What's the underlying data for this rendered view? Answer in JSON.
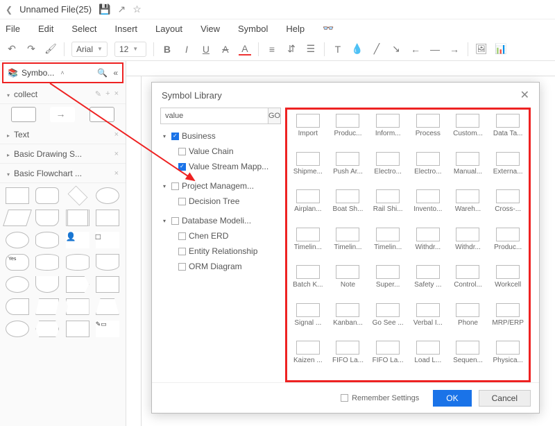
{
  "title": "Unnamed File(25)",
  "menu": [
    "File",
    "Edit",
    "Select",
    "Insert",
    "Layout",
    "View",
    "Symbol",
    "Help"
  ],
  "font": {
    "family": "Arial",
    "size": "12"
  },
  "sidebar": {
    "head": "Symbo...",
    "collect": "collect",
    "text": "Text",
    "basicDraw": "Basic Drawing S...",
    "basicFlow": "Basic Flowchart ..."
  },
  "dialog": {
    "title": "Symbol Library",
    "search": "value",
    "go": "GO",
    "tree": {
      "business": "Business",
      "valueChain": "Value Chain",
      "vsm": "Value Stream Mapp...",
      "pm": "Project Managem...",
      "decision": "Decision Tree",
      "db": "Database Modeli...",
      "chen": "Chen ERD",
      "er": "Entity Relationship",
      "orm": "ORM Diagram"
    },
    "icons": [
      "Import",
      "Produc...",
      "Inform...",
      "Process",
      "Custom...",
      "Data Ta...",
      "Shipme...",
      "Push Ar...",
      "Electro...",
      "Electro...",
      "Manual...",
      "Externa...",
      "Airplan...",
      "Boat Sh...",
      "Rail Shi...",
      "Invento...",
      "Wareh...",
      "Cross-...",
      "Timelin...",
      "Timelin...",
      "Timelin...",
      "Withdr...",
      "Withdr...",
      "Produc...",
      "Batch K...",
      "Note",
      "Super...",
      "Safety ...",
      "Control...",
      "Workcell",
      "Signal ...",
      "Kanban...",
      "Go See ...",
      "Verbal I...",
      "Phone",
      "MRP/ERP",
      "Kaizen ...",
      "FIFO La...",
      "FIFO La...",
      "Load L...",
      "Sequen...",
      "Physica..."
    ],
    "remember": "Remember Settings",
    "ok": "OK",
    "cancel": "Cancel"
  }
}
